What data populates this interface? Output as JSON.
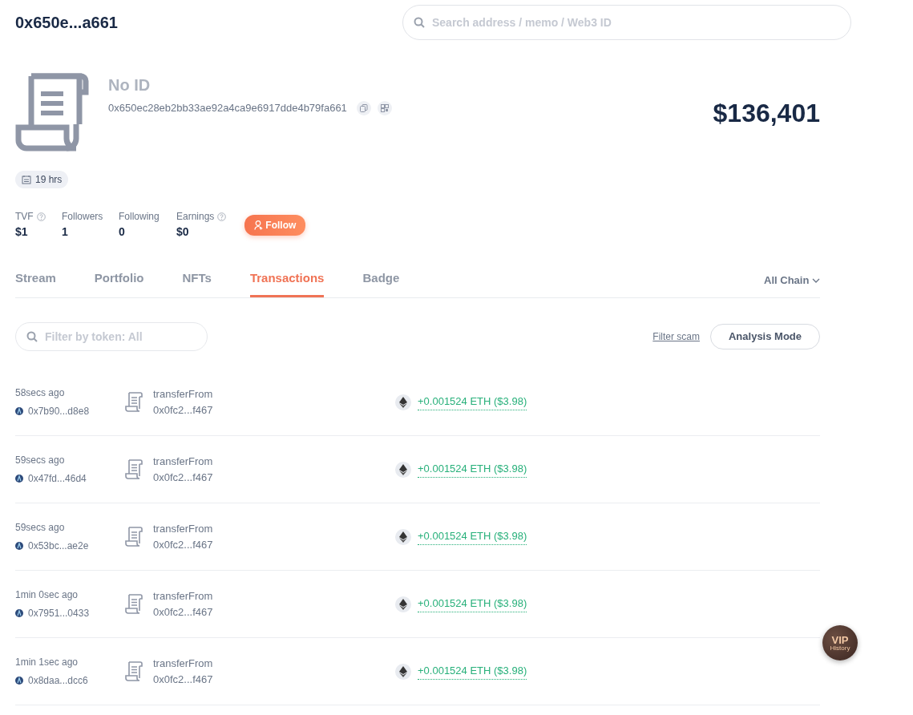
{
  "header": {
    "title": "0x650e...a661",
    "search": {
      "placeholder": "Search address / memo / Web3 ID"
    }
  },
  "profile": {
    "name": "No ID",
    "address": "0x650ec28eb2bb33ae92a4ca9e6917dde4b79fa661",
    "total": "$136,401",
    "age": "19 hrs",
    "stats": [
      {
        "label": "TVF",
        "value": "$1",
        "help": true
      },
      {
        "label": "Followers",
        "value": "1",
        "help": false
      },
      {
        "label": "Following",
        "value": "0",
        "help": false
      },
      {
        "label": "Earnings",
        "value": "$0",
        "help": true
      }
    ],
    "follow_button": "Follow"
  },
  "tabs": [
    {
      "label": "Stream",
      "selected": false
    },
    {
      "label": "Portfolio",
      "selected": false
    },
    {
      "label": "NFTs",
      "selected": false
    },
    {
      "label": "Transactions",
      "selected": true
    },
    {
      "label": "Badge",
      "selected": false
    }
  ],
  "chain_selector": "All Chain",
  "filter": {
    "placeholder": "Filter by token: All"
  },
  "filter_scam": "Filter scam",
  "analysis_button": "Analysis Mode",
  "transactions": [
    {
      "time": "58secs ago",
      "address": "0x7b90...d8e8",
      "method": "transferFrom",
      "contract": "0x0fc2...f467",
      "amount": "+0.001524 ETH ($3.98)"
    },
    {
      "time": "59secs ago",
      "address": "0x47fd...46d4",
      "method": "transferFrom",
      "contract": "0x0fc2...f467",
      "amount": "+0.001524 ETH ($3.98)"
    },
    {
      "time": "59secs ago",
      "address": "0x53bc...ae2e",
      "method": "transferFrom",
      "contract": "0x0fc2...f467",
      "amount": "+0.001524 ETH ($3.98)"
    },
    {
      "time": "1min 0sec ago",
      "address": "0x7951...0433",
      "method": "transferFrom",
      "contract": "0x0fc2...f467",
      "amount": "+0.001524 ETH ($3.98)"
    },
    {
      "time": "1min 1sec ago",
      "address": "0x8daa...dcc6",
      "method": "transferFrom",
      "contract": "0x0fc2...f467",
      "amount": "+0.001524 ETH ($3.98)"
    }
  ],
  "vip_button": {
    "title": "VIP",
    "subtitle": "History"
  }
}
